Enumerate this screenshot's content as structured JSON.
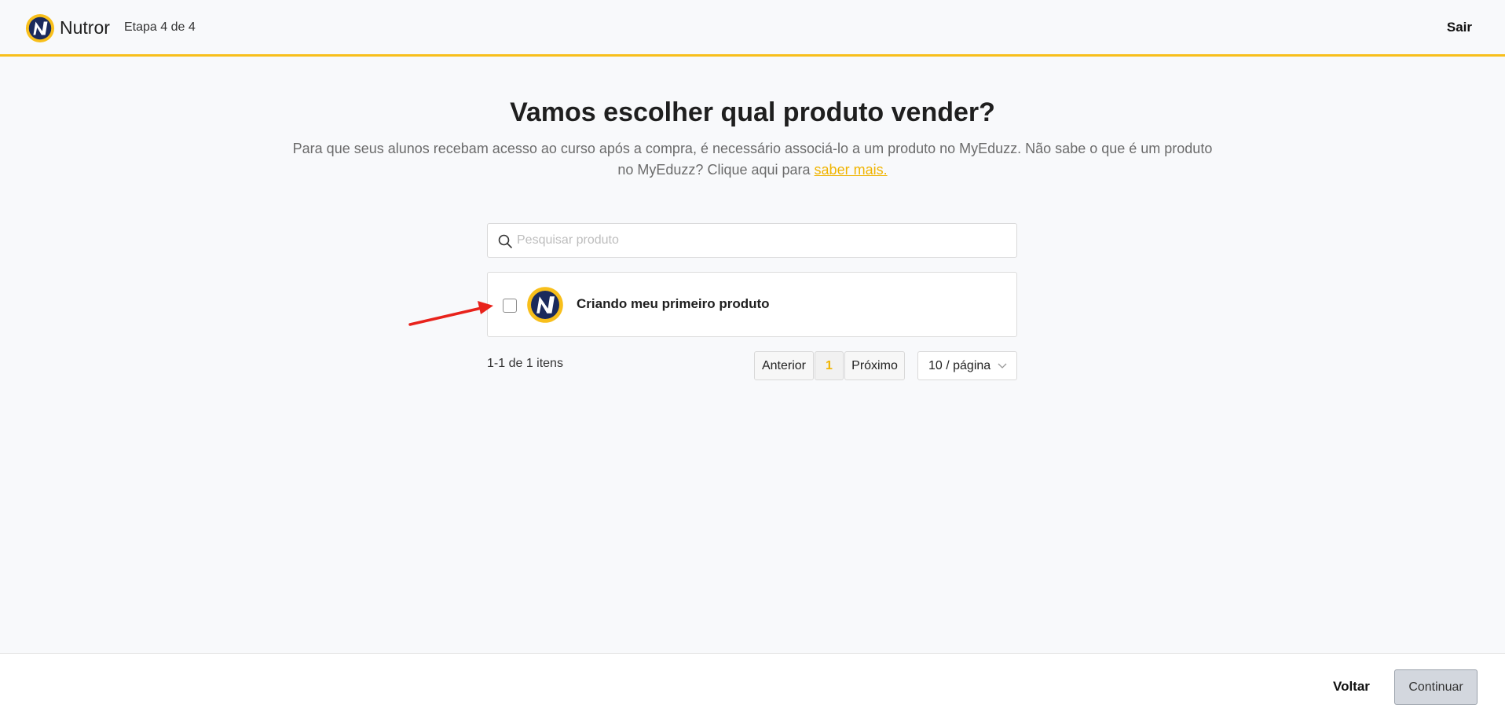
{
  "header": {
    "brand": "Nutror",
    "step": "Etapa 4 de 4",
    "exit_label": "Sair",
    "accent_color": "#f8bf1b"
  },
  "main": {
    "title": "Vamos escolher qual produto vender?",
    "subtitle_text": "Para que seus alunos recebam acesso ao curso após a compra, é necessário associá-lo a um produto no MyEduzz. Não sabe o que é um produto no MyEduzz? Clique aqui para ",
    "subtitle_link": "saber mais.",
    "search": {
      "placeholder": "Pesquisar produto",
      "value": ""
    },
    "products": [
      {
        "name": "Criando meu primeiro produto",
        "checked": false,
        "icon": "nutror-logo-icon"
      }
    ],
    "pagination": {
      "count_text": "1-1 de 1 itens",
      "prev_label": "Anterior",
      "current_page": "1",
      "next_label": "Próximo",
      "page_size": "10 / página"
    }
  },
  "footer": {
    "back_label": "Voltar",
    "continue_label": "Continuar"
  },
  "annotation": {
    "arrow_color": "#e8221b"
  }
}
